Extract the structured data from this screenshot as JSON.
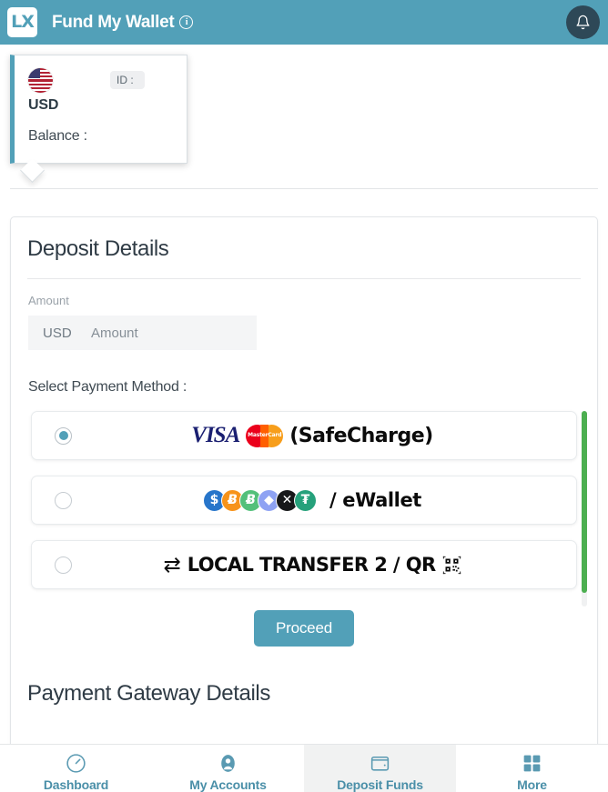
{
  "header": {
    "logo_text": "LX",
    "logo_name": "lx-logo",
    "title": "Fund My Wallet",
    "info_glyph": "i",
    "bell_icon": "bell-icon",
    "bg_color": "#52a0b8",
    "bell_bg_color": "#2e4857"
  },
  "account_card": {
    "flag_icon": "us-flag-icon",
    "id_label": "ID :",
    "currency": "USD",
    "balance_label": "Balance :",
    "accent_color": "#52a0b8"
  },
  "deposit": {
    "title": "Deposit Details",
    "amount_label": "Amount",
    "amount_currency": "USD",
    "amount_placeholder": "Amount",
    "amount_value": "",
    "select_method_label": "Select Payment Method :",
    "methods": [
      {
        "id": "safecharge",
        "selected": true,
        "brands": [
          "VISA",
          "MasterCard"
        ],
        "visa_text": "VISA",
        "mastercard_text": "MasterCard",
        "label": "(SafeCharge)"
      },
      {
        "id": "ewallet",
        "selected": false,
        "coins": [
          {
            "name": "usdc-icon",
            "glyph": "$",
            "color": "#2775ca"
          },
          {
            "name": "bitcoin-icon",
            "glyph": "Ƀ",
            "color": "#f7931a"
          },
          {
            "name": "bitcoin-cash-icon",
            "glyph": "Ƀ",
            "color": "#53c07a"
          },
          {
            "name": "ethereum-icon",
            "glyph": "◆",
            "color": "#8ea2f3"
          },
          {
            "name": "xrp-icon",
            "glyph": "✕",
            "color": "#17181a"
          },
          {
            "name": "tether-icon",
            "glyph": "₮",
            "color": "#26a17b"
          }
        ],
        "label": "/ eWallet"
      },
      {
        "id": "local-transfer-2",
        "selected": false,
        "arrows_glyph": "⇄",
        "label": "LOCAL TRANSFER 2 / QR",
        "qr_icon": "qr-code-icon"
      }
    ],
    "proceed_label": "Proceed",
    "scrollbar_color": "#4caf50"
  },
  "gateway": {
    "title": "Payment Gateway Details"
  },
  "bottom_nav": {
    "items": [
      {
        "label": "Dashboard",
        "icon": "speedometer-icon",
        "active": false
      },
      {
        "label": "My Accounts",
        "icon": "person-icon",
        "active": false
      },
      {
        "label": "Deposit Funds",
        "icon": "wallet-icon",
        "active": true
      },
      {
        "label": "More",
        "icon": "grid-icon",
        "active": false
      }
    ],
    "accent_color": "#4a8fa8"
  }
}
